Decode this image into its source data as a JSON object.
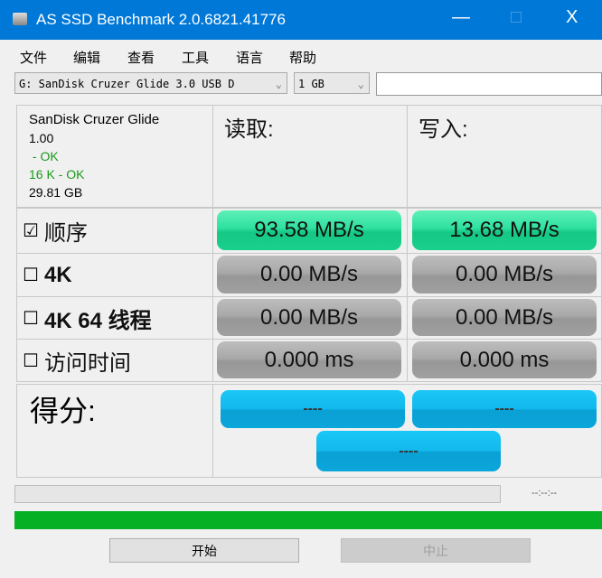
{
  "window": {
    "title": "AS SSD Benchmark 2.0.6821.41776",
    "minimize": "—",
    "maximize": "□",
    "close": "X"
  },
  "menu": [
    "文件",
    "编辑",
    "查看",
    "工具",
    "语言",
    "帮助"
  ],
  "drive_select": "G: SanDisk Cruzer Glide 3.0 USB D",
  "size_select": "1 GB",
  "text_field": "",
  "info": {
    "name": "SanDisk Cruzer Glide",
    "version": "1.00",
    "status1": " - OK",
    "status2": "16 K - OK",
    "capacity": "29.81 GB"
  },
  "headers": {
    "read": "读取:",
    "write": "写入:"
  },
  "rows": [
    {
      "label": "顺序",
      "checked": "☑",
      "read": "93.58 MB/s",
      "write": "13.68 MB/s"
    },
    {
      "label": "4K",
      "checked": "☐",
      "read": "0.00 MB/s",
      "write": "0.00 MB/s"
    },
    {
      "label": "4K 64 线程",
      "checked": "☐",
      "read": "0.00 MB/s",
      "write": "0.00 MB/s"
    },
    {
      "label": "访问时间",
      "checked": "☐",
      "read": "0.000 ms",
      "write": "0.000 ms"
    }
  ],
  "score": {
    "label": "得分:",
    "read": "----",
    "write": "----",
    "total": "----"
  },
  "timer": "--:--:--",
  "progress": 1.0,
  "buttons": {
    "start": "开始",
    "abort": "中止"
  }
}
